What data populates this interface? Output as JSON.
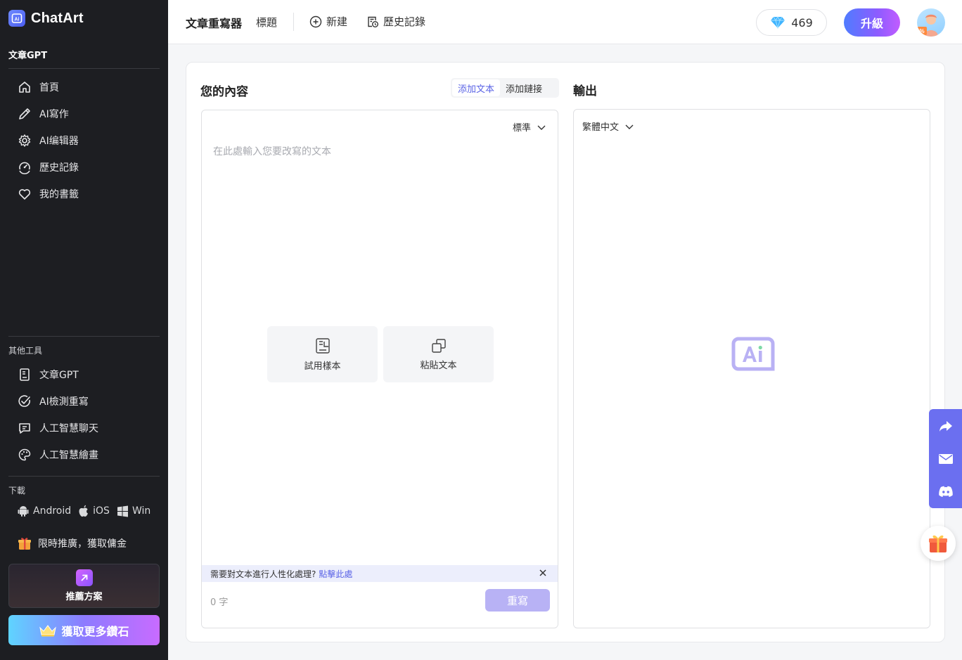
{
  "app": {
    "name": "ChatArt"
  },
  "sidebar": {
    "section_main": "文章GPT",
    "items": [
      {
        "label": "首頁",
        "icon": "home-icon"
      },
      {
        "label": "AI寫作",
        "icon": "pen-icon"
      },
      {
        "label": "AI编辑器",
        "icon": "gear-icon"
      },
      {
        "label": "歷史記錄",
        "icon": "history-icon"
      },
      {
        "label": "我的書籤",
        "icon": "heart-icon"
      }
    ],
    "section_tools": "其他工具",
    "tools": [
      {
        "label": "文章GPT",
        "icon": "document-icon"
      },
      {
        "label": "AI檢測重寫",
        "icon": "check-circle-icon"
      },
      {
        "label": "人工智慧聊天",
        "icon": "chat-icon"
      },
      {
        "label": "人工智慧繪畫",
        "icon": "palette-icon"
      }
    ],
    "section_download": "下載",
    "downloads": {
      "android": "Android",
      "ios": "iOS",
      "win": "Win"
    },
    "promo": "限時推廣，獲取傭金",
    "recommend": "推薦方案",
    "get_more": "獲取更多鑽石"
  },
  "topbar": {
    "title": "文章重寫器",
    "subtitle": "標題",
    "new_label": "新建",
    "history_label": "歷史記錄",
    "diamonds": "469",
    "upgrade": "升級"
  },
  "main": {
    "input_title": "您的內容",
    "tab_add_text": "添加文本",
    "tab_add_link": "添加鏈接",
    "output_title": "輸出",
    "mode_select": "標準",
    "language_select": "繁體中文",
    "placeholder": "在此處輸入您要改寫的文本",
    "try_sample": "試用樣本",
    "paste_text": "粘貼文本",
    "notice": "需要對文本進行人性化處理?",
    "notice_link": "點擊此處",
    "word_count": "0 字",
    "rewrite": "重寫"
  },
  "colors": {
    "accent": "#5b64e6",
    "sidebar_bg": "#1d1e22",
    "float_bar": "#6b6ff0"
  }
}
